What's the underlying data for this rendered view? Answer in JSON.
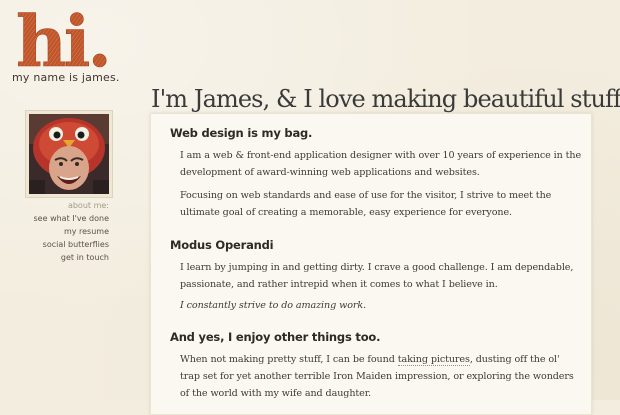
{
  "logo": {
    "text": "hi.",
    "tagline": "my name is james.",
    "color": "#c0542a"
  },
  "avatar": {
    "icon": "profile-photo"
  },
  "nav": {
    "heading": "about me:",
    "items": [
      {
        "label": "see what I've done"
      },
      {
        "label": "my resume"
      },
      {
        "label": "social butterflies"
      },
      {
        "label": "get in touch"
      }
    ]
  },
  "headline": "I'm James, & I love making beautiful stuff.",
  "sections": [
    {
      "title": "Web design is my bag.",
      "paragraphs": [
        "I am a web & front-end application designer with over 10 years of experience in the development of award-winning web applications and websites.",
        "Focusing on web standards and ease of use for the visitor, I strive to meet the ultimate goal of creating a memorable, easy experience for everyone."
      ]
    },
    {
      "title": "Modus Operandi",
      "paragraphs": [
        "I learn by jumping in and getting dirty.  I crave a good challenge.  I am dependable, passionate, and rather intrepid when it comes to what I believe in.",
        "I constantly strive to do amazing work."
      ]
    },
    {
      "title": "And yes, I enjoy other things too.",
      "p1_before": "When not making pretty stuff, I can be found ",
      "p1_link": "taking pictures",
      "p1_after": ", dusting off the ol' trap set for yet another terrible Iron Maiden impression, or exploring the wonders of the world with my wife and daughter."
    }
  ]
}
